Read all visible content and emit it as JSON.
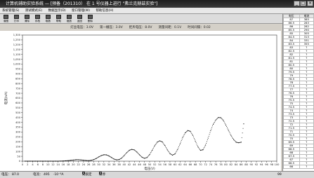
{
  "window": {
    "title": "计算机辅助实验系统 — [预备（201310） 在 1 号仪器上进行 \"弗兰克赫兹实验\"]",
    "min": "_",
    "max": "□",
    "close": "×"
  },
  "menu": [
    "系统管理(S)",
    "测试模式(E)",
    "数据显示(D)",
    "窗口管理(W)",
    "帮助信息(H)"
  ],
  "toolbar": [
    "谱图",
    "打印",
    "清除",
    "存档",
    "取数",
    "帮助",
    "缩放",
    "返回",
    "删除"
  ],
  "info": "灯丝电压：3.0V　　第一栅压：3.0V　　拒斥电压：8.0V　　测量间距：0.1V　　时间间隔：0.02",
  "statusbar": {
    "voltage_label": "电压：",
    "voltage_value": "87.0",
    "current_label": "电流：",
    "current_value": "495",
    "unit": "·10⁻⁸A",
    "check1": "无锁定",
    "check2": "暂停",
    "right_value": "99"
  },
  "table": {
    "headers": [
      "电压",
      "电流"
    ],
    "rows": [
      [
        "87",
        "385"
      ],
      [
        "86.5",
        "283"
      ],
      [
        "86",
        "282"
      ],
      [
        "85.5",
        "290"
      ],
      [
        "85",
        "305"
      ],
      [
        "84.5",
        "313"
      ],
      [
        "84",
        "331"
      ],
      [
        "83.5",
        "355"
      ],
      [
        "83",
        "?"
      ],
      [
        "82.5",
        "?"
      ],
      [
        "82",
        "?"
      ],
      [
        "81.5",
        "?"
      ],
      [
        "81",
        "?"
      ],
      [
        "80.5",
        "?"
      ],
      [
        "80",
        "?"
      ],
      [
        "79.5",
        "?"
      ],
      [
        "79",
        "?"
      ],
      [
        "78.5",
        "?"
      ],
      [
        "78",
        "?"
      ],
      [
        "77.5",
        "?"
      ],
      [
        "77",
        "?"
      ],
      [
        "76.5",
        "?"
      ],
      [
        "76",
        "?"
      ],
      [
        "75.5",
        "?"
      ],
      [
        "75",
        "?"
      ],
      [
        "74.5",
        "?"
      ],
      [
        "74",
        "?"
      ],
      [
        "73.5",
        "?"
      ],
      [
        "73",
        "?"
      ],
      [
        "72.5",
        "?"
      ],
      [
        "72",
        "?"
      ],
      [
        "71.5",
        "?"
      ],
      [
        "71",
        "?"
      ],
      [
        "70.5",
        "?"
      ],
      [
        "70",
        "?"
      ],
      [
        "69.5",
        "?"
      ],
      [
        "69",
        "?"
      ],
      [
        "68.5",
        "?"
      ],
      [
        "68",
        "?"
      ],
      [
        "67.5",
        "?"
      ],
      [
        "67",
        "?"
      ],
      [
        "66.5",
        "?"
      ],
      [
        "66",
        "?"
      ]
    ]
  },
  "chart_data": {
    "type": "scatter",
    "xlabel": "电压(V)",
    "ylabel": "电流(nA)",
    "xlim": [
      0,
      100
    ],
    "ylim": [
      0,
      1300
    ],
    "xticks": [
      0,
      2,
      4,
      6,
      8,
      10,
      12,
      14,
      16,
      18,
      20,
      22,
      24,
      26,
      28,
      30,
      32,
      34,
      36,
      38,
      40,
      42,
      44,
      46,
      48,
      50,
      52,
      54,
      56,
      58,
      60,
      62,
      64,
      66,
      68,
      70,
      72,
      74,
      76,
      78,
      80,
      82,
      84,
      86,
      88,
      90,
      92,
      94,
      96,
      98,
      100
    ],
    "yticks": [
      0,
      50,
      100,
      150,
      200,
      250,
      300,
      350,
      400,
      450,
      500,
      550,
      600,
      650,
      700,
      750,
      800,
      850,
      900,
      950,
      1000,
      1050,
      1100,
      1150,
      1200,
      1250,
      1300
    ],
    "grid": false,
    "series": [
      {
        "x": [
          1,
          2,
          3,
          4,
          5,
          6,
          7,
          8,
          9,
          10,
          11,
          12,
          13,
          14,
          15,
          16,
          17,
          18,
          19,
          20,
          21,
          22,
          23,
          24,
          25,
          26,
          27,
          28,
          29,
          30,
          31,
          32,
          33,
          34,
          35,
          36,
          37,
          38,
          39,
          40,
          41,
          42,
          43,
          44,
          45,
          46,
          47,
          48,
          49,
          50,
          51,
          52,
          53,
          54,
          55,
          56,
          57,
          58,
          59,
          60,
          61,
          62,
          63,
          64,
          65,
          66,
          67,
          68,
          69,
          70,
          71,
          72,
          73,
          74,
          75,
          76,
          77,
          78,
          79,
          80,
          81,
          82,
          83,
          84,
          85,
          86,
          87
        ],
        "y": [
          0,
          0,
          0,
          0,
          0,
          0,
          0,
          0,
          0,
          0,
          0,
          0,
          0,
          0,
          1,
          2,
          4,
          6,
          9,
          12,
          15,
          15,
          13,
          10,
          7,
          6,
          9,
          16,
          28,
          44,
          58,
          66,
          65,
          54,
          38,
          22,
          14,
          17,
          32,
          58,
          88,
          112,
          122,
          116,
          94,
          66,
          41,
          30,
          38,
          68,
          112,
          160,
          196,
          210,
          198,
          162,
          116,
          78,
          62,
          76,
          120,
          180,
          244,
          292,
          316,
          308,
          266,
          206,
          148,
          112,
          118,
          166,
          238,
          314,
          380,
          424,
          450,
          448,
          420,
          372,
          318,
          266,
          224,
          196,
          190,
          196,
          385
        ]
      }
    ]
  }
}
